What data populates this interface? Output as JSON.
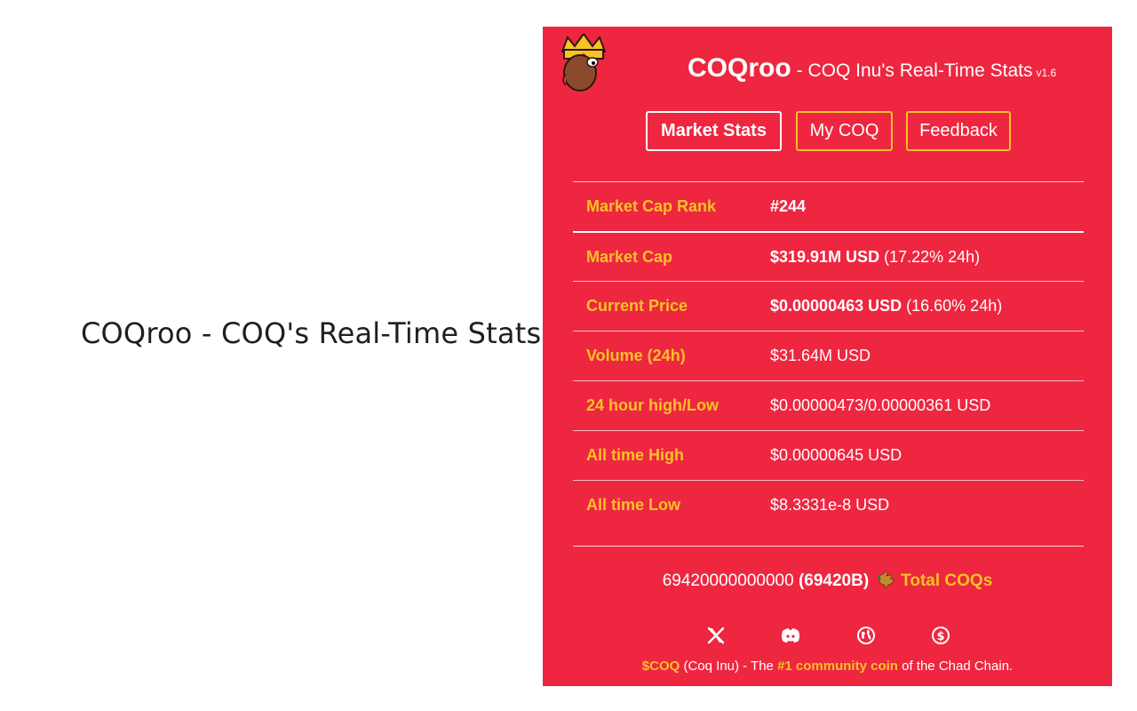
{
  "left_caption": "COQroo - COQ's Real-Time Stats",
  "header": {
    "brand": "COQroo",
    "subtitle": "- COQ Inu's Real-Time Stats",
    "version": "v1.6"
  },
  "tabs": [
    {
      "label": "Market Stats",
      "active": true
    },
    {
      "label": "My COQ",
      "active": false
    },
    {
      "label": "Feedback",
      "active": false
    }
  ],
  "stats": [
    {
      "key": "Market Cap Rank",
      "value_bold": "#244",
      "value_extra": ""
    },
    {
      "key": "Market Cap",
      "value_bold": "$319.91M USD",
      "value_extra": "(17.22% 24h)"
    },
    {
      "key": "Current Price",
      "value_bold": "$0.00000463 USD",
      "value_extra": "(16.60% 24h)"
    },
    {
      "key": "Volume (24h)",
      "value_bold": "",
      "value_extra": "$31.64M USD"
    },
    {
      "key": "24 hour high/Low",
      "value_bold": "",
      "value_extra": "$0.00000473/0.00000361 USD"
    },
    {
      "key": "All time High",
      "value_bold": "",
      "value_extra": "$0.00000645 USD"
    },
    {
      "key": "All time Low",
      "value_bold": "",
      "value_extra": "$8.3331e-8 USD"
    }
  ],
  "supply": {
    "amount": "69420000000000",
    "amount_short": "(69420B)",
    "label": "Total COQs"
  },
  "socials": [
    "x-icon",
    "discord-icon",
    "globe-icon",
    "coin-icon"
  ],
  "footer": {
    "ticker": "$COQ",
    "name": "(Coq Inu) - The",
    "highlight": "#1 community coin",
    "suffix": "of the Chad Chain."
  },
  "colors": {
    "background": "#ee2640",
    "accent": "#f7c325",
    "text": "#ffffff"
  }
}
